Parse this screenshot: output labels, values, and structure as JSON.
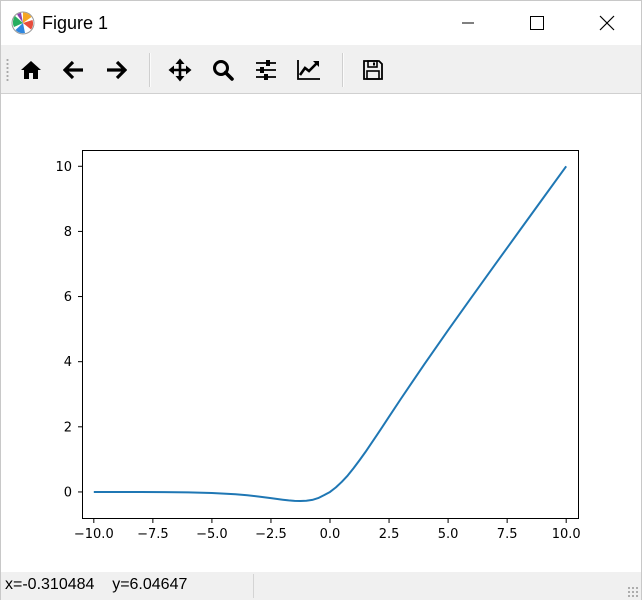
{
  "window": {
    "title": "Figure 1"
  },
  "toolbar": {
    "buttons": [
      {
        "name": "home-button",
        "icon": "home-icon"
      },
      {
        "name": "back-button",
        "icon": "arrow-left-icon"
      },
      {
        "name": "forward-button",
        "icon": "arrow-right-icon"
      },
      {
        "name": "pan-button",
        "icon": "move-icon"
      },
      {
        "name": "zoom-button",
        "icon": "magnifier-icon"
      },
      {
        "name": "configure-subplots-button",
        "icon": "sliders-icon"
      },
      {
        "name": "edit-axis-button",
        "icon": "line-chart-icon"
      },
      {
        "name": "save-button",
        "icon": "floppy-disk-icon"
      }
    ]
  },
  "status": {
    "coordinates": "x=-0.310484    y=6.04647"
  },
  "colors": {
    "line": "#1f77b4",
    "toolbar_bg": "#f0f0f0"
  },
  "chart_data": {
    "type": "line",
    "title": "",
    "xlabel": "",
    "ylabel": "",
    "xlim": [
      -10.5,
      10.5
    ],
    "ylim": [
      -0.8,
      10.5
    ],
    "xticks": [
      -10.0,
      -7.5,
      -5.0,
      -2.5,
      0.0,
      2.5,
      5.0,
      7.5,
      10.0
    ],
    "xtick_labels": [
      "−10.0",
      "−7.5",
      "−5.0",
      "−2.5",
      "0.0",
      "2.5",
      "5.0",
      "7.5",
      "10.0"
    ],
    "yticks": [
      0,
      2,
      4,
      6,
      8,
      10
    ],
    "ytick_labels": [
      "0",
      "2",
      "4",
      "6",
      "8",
      "10"
    ],
    "grid": false,
    "series": [
      {
        "x": [
          -10,
          -9,
          -8,
          -7,
          -6,
          -5,
          -4.5,
          -4,
          -3.5,
          -3,
          -2.5,
          -2,
          -1.75,
          -1.5,
          -1.25,
          -1,
          -0.75,
          -0.5,
          -0.25,
          0,
          0.25,
          0.5,
          0.75,
          1,
          1.25,
          1.5,
          1.75,
          2,
          2.5,
          3,
          3.5,
          4,
          5,
          6,
          7,
          8,
          9,
          10
        ],
        "y": [
          -0.0005,
          -0.0011,
          -0.0027,
          -0.0064,
          -0.0148,
          -0.0335,
          -0.0497,
          -0.0719,
          -0.1017,
          -0.1423,
          -0.1896,
          -0.2384,
          -0.2595,
          -0.2736,
          -0.2778,
          -0.2689,
          -0.2446,
          -0.1888,
          -0.0976,
          0,
          0.1399,
          0.3112,
          0.5047,
          0.7311,
          0.9735,
          1.2263,
          1.4919,
          1.7616,
          2.3104,
          2.8577,
          3.3944,
          3.9281,
          4.9665,
          5.9852,
          6.9936,
          7.9973,
          8.9989,
          9.9995
        ]
      }
    ]
  }
}
